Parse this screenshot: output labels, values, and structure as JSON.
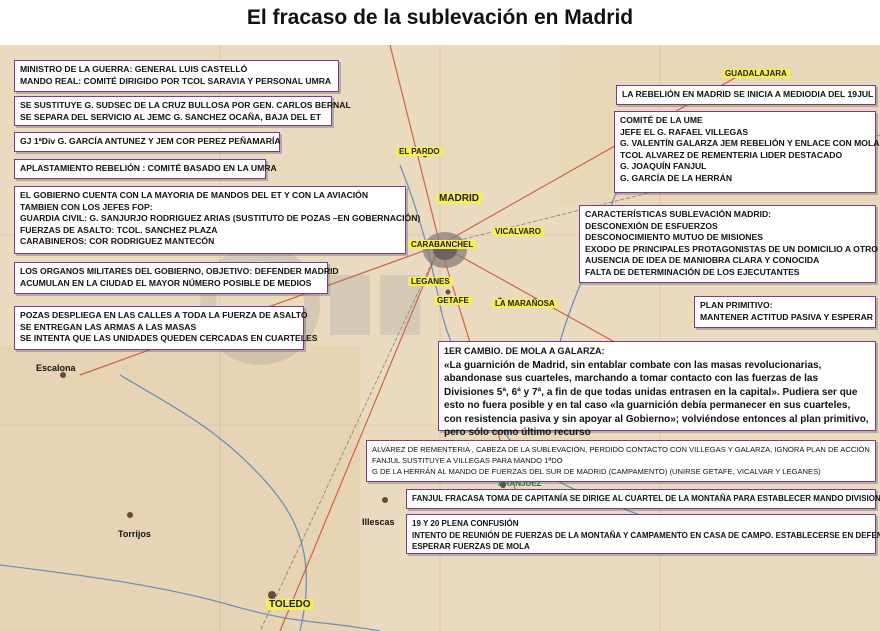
{
  "title": "El fracaso de la sublevación en Madrid",
  "map": {
    "places": {
      "guadalajara": "GUADALAJARA",
      "el_pardo": "EL PARDO",
      "madrid": "MADRID",
      "carabanchel": "CARABANCHEL",
      "vicalvaro": "VICALVARO",
      "leganes": "LEGANES",
      "getafe": "GETAFE",
      "la_maranosa": "LA MARAÑOSA",
      "aranjuez": "ARANJUEZ",
      "toledo": "TOLEDO",
      "escalona": "Escalona",
      "torrijos": "Torrijos",
      "illescas": "Illescas"
    },
    "colors": {
      "map_bg": "#eadbc0",
      "box_border": "#7a3b8f",
      "place_highlight": "#f4ee58",
      "place_green": "#1f7a2a",
      "roads": "#c9452a",
      "rivers": "#4a78b5"
    }
  },
  "boxes": {
    "ministro": {
      "lines": [
        "MINISTRO DE LA GUERRA: GENERAL LUIS CASTELLÓ",
        "MANDO REAL: COMITÉ  DIRIGIDO POR  TCOL SARAVIA Y PERSONAL UMRA"
      ]
    },
    "sustituye": {
      "lines": [
        "SE SUSTITUYE G. SUDSEC DE LA CRUZ BULLOSA POR  GEN. CARLOS BERNAL",
        "SE  SEPARA DEL SERVICIO AL JEMC  G. SANCHEZ OCAÑA, BAJA DEL ET"
      ]
    },
    "gj1div": {
      "lines": [
        "GJ 1ªDiv  G. GARCÍA ANTUNEZ Y JEM COR PEREZ PEÑAMARÍA"
      ]
    },
    "aplastamiento": {
      "lines": [
        "APLASTAMIENTO REBELIÓN : COMITÉ BASADO EN LA UMRA"
      ]
    },
    "gobierno": {
      "lines": [
        "EL GOBIERNO CUENTA CON LA MAYORIA DE MANDOS DEL ET Y CON LA AVIACIÓN",
        "TAMBIEN CON  LOS JEFES FOP:",
        "GUARDIA CIVIL: G. SANJURJO RODRIGUEZ ARIAS (SUSTITUTO DE POZAS –EN GOBERNACIÓN)",
        "FUERZAS DE ASALTO: TCOL. SANCHEZ PLAZA",
        "CARABINEROS: COR RODRIGUEZ MANTECÓN"
      ]
    },
    "organos": {
      "lines": [
        "LOS ORGANOS MILITARES DEL GOBIERNO, OBJETIVO: DEFENDER MADRID",
        "ACUMULAN EN LA CIUDAD EL MAYOR NÚMERO POSIBLE DE MEDIOS"
      ]
    },
    "pozas": {
      "lines": [
        "POZAS DESPLIEGA EN LAS CALLES A TODA LA FUERZA DE ASALTO",
        "SE ENTREGAN LAS ARMAS A LAS MASAS",
        "SE INTENTA QUE LAS UNIDADES QUEDEN CERCADAS EN CUARTELES"
      ]
    },
    "rebelion": {
      "lines": [
        "LA REBELIÓN EN MADRID SE INICIA A MEDIODIA DEL 19JUL"
      ]
    },
    "comite_ume": {
      "lines": [
        "COMITÉ DE LA UME",
        "JEFE EL G. RAFAEL VILLEGAS",
        "G. VALENTÍN GALARZA JEM REBELIÓN Y ENLACE CON MOLA",
        "TCOL ALVAREZ DE REMENTERIA  LIDER DESTACADO",
        "G. JOAQUÍN FANJUL",
        "G. GARCÍA DE LA HERRÁN"
      ]
    },
    "caracteristicas": {
      "lines": [
        "CARACTERÍSTICAS SUBLEVACIÓN MADRID:",
        "DESCONEXIÓN DE ESFUERZOS",
        "DESCONOCIMIENTO MUTUO DE MISIONES",
        "EXODO DE PRINCIPALES PROTAGONISTAS DE UN DOMICILIO A OTRO",
        "AUSENCIA DE IDEA DE MANIOBRA CLARA Y CONOCIDA",
        "FALTA DE DETERMINACIÓN DE LOS EJECUTANTES"
      ]
    },
    "plan": {
      "lines": [
        "PLAN PRIMITIVO:",
        "MANTENER ACTITUD PASIVA Y ESPERAR"
      ]
    },
    "cambio": {
      "heading": "1ER CAMBIO. DE MOLA A GALARZA:",
      "text": "«La guarnición de Madrid, sin entablar combate con las masas revolucionarias, abandonase sus cuarteles, marchando a tomar contacto con las fuerzas de las Divisiones 5ª, 6ª y 7ª, a fin de que todas unidas entrasen en la capital». Pudiera ser que esto no fuera posible y en tal caso «la guarnición debía permanecer en sus cuarteles, con resistencia pasiva y sin apoyar al Gobierno»; volviéndose entonces al plan primitivo, pero sólo como último recurso"
    },
    "alvarez": {
      "lines": [
        "ALVAREZ DE REMENTERIA , CABEZA DE LA SUBLEVACIÓN, PERDIDO CONTACTO CON VILLEGAS Y GALARZA, IGNORA PLAN DE ACCIÓN",
        "FANJUL SUSTITUYE A VILLEGAS PARA MANDO 1ªDO",
        "G DE LA HERRÁN AL MANDO DE  FUERZAS DEL SUR DE MADRID (CAMPAMENTO) (UNIRSE GETAFE, VICALVAR Y LEGANES)"
      ]
    },
    "fanjul": {
      "lines": [
        "FANJUL FRACASA TOMA DE  CAPITANÍA SE DIRIGE AL CUARTEL DE LA MONTAÑA PARA ESTABLECER MANDO DIVISIONARIO"
      ]
    },
    "confusion": {
      "lines": [
        "19 Y 20 PLENA CONFUSIÓN",
        "INTENTO DE REUNIÓN DE FUERZAS DE LA MONTAÑA Y CAMPAMENTO EN CASA DE CAMPO. ESTABLECERSE EN DEFENSIVA",
        "ESPERAR FUERZAS DE MOLA"
      ]
    }
  }
}
